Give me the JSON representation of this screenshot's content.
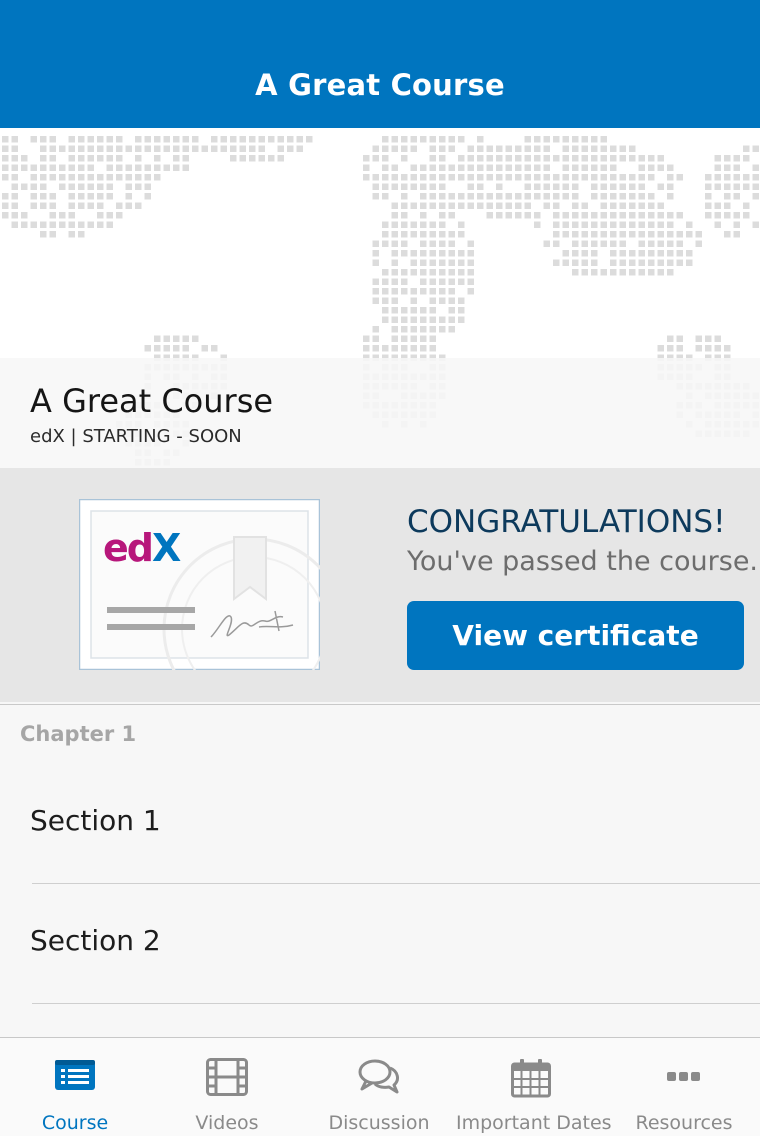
{
  "navbar": {
    "title": "A Great Course"
  },
  "course": {
    "title": "A Great Course",
    "subtitle": "edX | STARTING - SOON"
  },
  "certificate": {
    "logo_text": "edX",
    "heading": "CONGRATULATIONS!",
    "message": "You've passed the course.",
    "button_label": "View certificate"
  },
  "outline": {
    "chapter": "Chapter 1",
    "sections": [
      "Section 1",
      "Section 2"
    ]
  },
  "tabs": [
    {
      "label": "Course",
      "icon": "course-list-icon",
      "active": true
    },
    {
      "label": "Videos",
      "icon": "film-icon",
      "active": false
    },
    {
      "label": "Discussion",
      "icon": "chat-bubbles-icon",
      "active": false
    },
    {
      "label": "Important Dates",
      "icon": "calendar-icon",
      "active": false
    },
    {
      "label": "Resources",
      "icon": "more-dots-icon",
      "active": false
    }
  ],
  "colors": {
    "brand_blue": "#0075bf",
    "heading_navy": "#0d3a5c",
    "edx_magenta": "#b7177b",
    "edx_blue": "#0075bf"
  }
}
